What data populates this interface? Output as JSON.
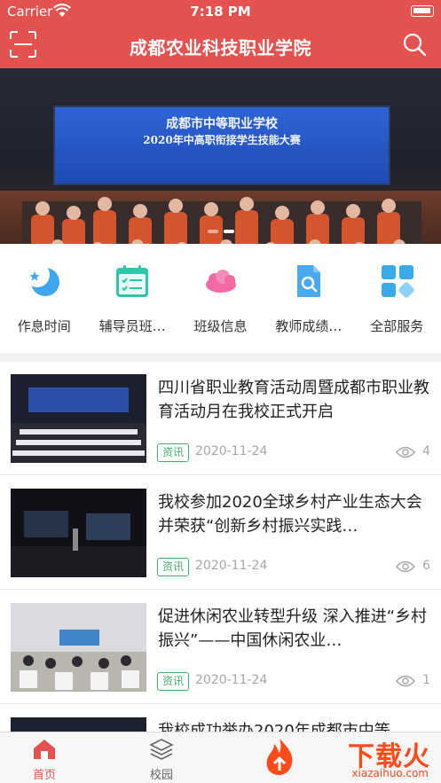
{
  "status_bar": {
    "carrier": "Carrier",
    "time": "7:18 PM"
  },
  "header": {
    "title": "成都农业科技职业学院",
    "scan_icon": "scan-icon",
    "search_icon": "search-icon"
  },
  "banner": {
    "screen_line1": "成都市中等职业学校",
    "screen_line2": "2020年中高职衔接学生技能大赛",
    "active_slide": 2,
    "total_slides": 2
  },
  "menu": [
    {
      "label": "作息时间",
      "icon": "moon-star-icon",
      "color": "#3ea6ef"
    },
    {
      "label": "辅导员班…",
      "icon": "calendar-check-icon",
      "color": "#2fc5a8"
    },
    {
      "label": "班级信息",
      "icon": "cloud-icon",
      "color": "#f26aa3"
    },
    {
      "label": "教师成绩…",
      "icon": "document-search-icon",
      "color": "#4aa8f0"
    },
    {
      "label": "全部服务",
      "icon": "grid-icon",
      "color": "#39a9e8"
    }
  ],
  "news": [
    {
      "title": "四川省职业教育活动周暨成都市职业教育活动月在我校正式开启",
      "tag": "资讯",
      "date": "2020-11-24",
      "views": "4"
    },
    {
      "title": "我校参加2020全球乡村产业生态大会并荣获“创新乡村振兴实践…",
      "tag": "资讯",
      "date": "2020-11-24",
      "views": "6"
    },
    {
      "title": "促进休闲农业转型升级 深入推进“乡村振兴”——中国休闲农业…",
      "tag": "资讯",
      "date": "2020-11-24",
      "views": "1"
    },
    {
      "title": "我校成功举办2020年成都市中等",
      "tag": "",
      "date": "",
      "views": ""
    }
  ],
  "tabbar": [
    {
      "label": "首页",
      "icon": "home-icon",
      "active": true
    },
    {
      "label": "校园",
      "icon": "layers-icon",
      "active": false
    }
  ],
  "watermark": {
    "text": "下载火",
    "url": "xiazaihuo.com"
  },
  "colors": {
    "primary": "#e4524f",
    "tag_green": "#43b36a",
    "tab_active": "#e4524f",
    "tab_inactive": "#666666"
  }
}
